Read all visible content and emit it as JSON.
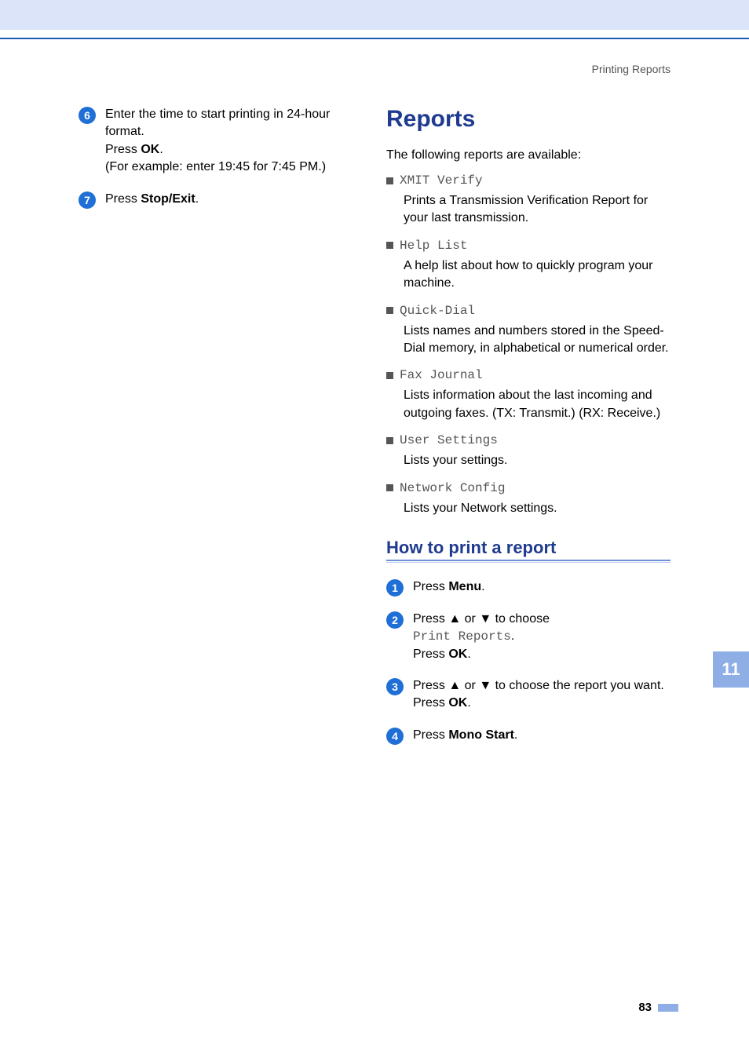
{
  "header": {
    "topic": "Printing Reports"
  },
  "left": {
    "steps": [
      {
        "num": "6",
        "line1": "Enter the time to start printing in 24-hour format.",
        "line2_pre": "Press ",
        "line2_bold": "OK",
        "line2_post": ".",
        "line3": "(For example: enter 19:45 for 7:45 PM.)"
      },
      {
        "num": "7",
        "line1_pre": "Press ",
        "line1_bold": "Stop/Exit",
        "line1_post": "."
      }
    ]
  },
  "right": {
    "title": "Reports",
    "intro": "The following reports are available:",
    "reports": [
      {
        "label": "XMIT Verify",
        "desc": "Prints a Transmission Verification Report for your last transmission."
      },
      {
        "label": "Help List",
        "desc": "A help list about how to quickly program your machine."
      },
      {
        "label": "Quick-Dial",
        "desc": "Lists names and numbers stored in the Speed-Dial memory, in alphabetical or numerical order."
      },
      {
        "label": "Fax Journal",
        "desc": "Lists information about the last incoming and outgoing faxes. (TX: Transmit.) (RX: Receive.)"
      },
      {
        "label": "User Settings",
        "desc": "Lists your settings."
      },
      {
        "label": "Network Config",
        "desc": "Lists your Network settings."
      }
    ],
    "subheading": "How to print a report",
    "steps": [
      {
        "num": "1",
        "pre": "Press ",
        "bold": "Menu",
        "post": "."
      },
      {
        "num": "2",
        "line1_pre": "Press ",
        "line1_mid1": "a",
        "line1_between": " or ",
        "line1_mid2": "b",
        "line1_post": " to choose ",
        "mono": "Print Reports",
        "mono_post": ".",
        "line3_pre": "Press ",
        "line3_bold": "OK",
        "line3_post": "."
      },
      {
        "num": "3",
        "line1_pre": "Press ",
        "line1_mid1": "a",
        "line1_between": " or ",
        "line1_mid2": "b",
        "line1_post": " to choose the report you want.",
        "line3_pre": "Press ",
        "line3_bold": "OK",
        "line3_post": "."
      },
      {
        "num": "4",
        "pre": "Press ",
        "bold": "Mono Start",
        "post": "."
      }
    ]
  },
  "sidebar": {
    "chapter": "11"
  },
  "footer": {
    "page": "83"
  }
}
